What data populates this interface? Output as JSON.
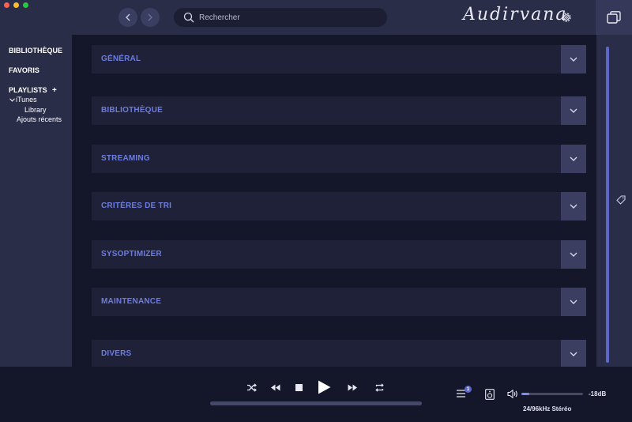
{
  "app": {
    "logo_text": "Audirvana"
  },
  "search": {
    "placeholder": "Rechercher"
  },
  "sidebar": {
    "library_label": "BIBLIOTHÈQUE",
    "favorites_label": "FAVORIS",
    "playlists_label": "PLAYLISTS",
    "add_playlist_label": "+",
    "tree": {
      "itunes_label": "iTunes",
      "children": [
        "Library",
        "Ajouts récents"
      ]
    }
  },
  "settings": {
    "sections": [
      {
        "label": "GÉNÉRAL"
      },
      {
        "label": "BIBLIOTHÈQUE"
      },
      {
        "label": "STREAMING"
      },
      {
        "label": "CRITÈRES DE TRI"
      },
      {
        "label": "SYSOPTIMIZER"
      },
      {
        "label": "MAINTENANCE"
      },
      {
        "label": "DIVERS"
      }
    ]
  },
  "player": {
    "queue_count": "1",
    "volume_db": "-18dB",
    "volume_level": 0.13,
    "progress": 0,
    "format": "24/96kHz Stéréo"
  },
  "colors": {
    "accent": "#5f68c8",
    "section_title": "#6d7ce0",
    "panel": "#2a2d48",
    "background": "#14162a"
  }
}
